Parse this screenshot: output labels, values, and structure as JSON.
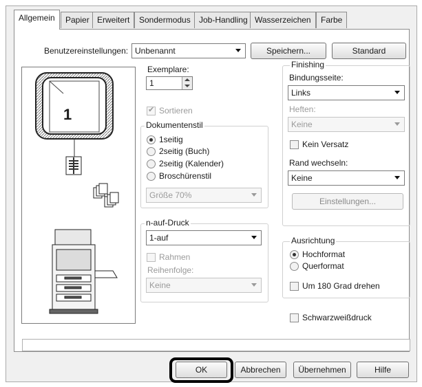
{
  "tabs": [
    {
      "label": "Allgemein"
    },
    {
      "label": "Papier"
    },
    {
      "label": "Erweitert"
    },
    {
      "label": "Sondermodus"
    },
    {
      "label": "Job-Handling"
    },
    {
      "label": "Wasserzeichen"
    },
    {
      "label": "Farbe"
    }
  ],
  "user_settings": {
    "label": "Benutzereinstellungen:",
    "value": "Unbenannt",
    "save_button": "Speichern...",
    "default_button": "Standard"
  },
  "preview": {
    "page_number": "1"
  },
  "copies": {
    "label": "Exemplare:",
    "value": "1",
    "collate_label": "Sortieren",
    "collate_checked": true,
    "collate_enabled": false
  },
  "document_style": {
    "title": "Dokumentenstil",
    "options": [
      "1seitig",
      "2seitig (Buch)",
      "2seitig (Kalender)",
      "Broschürenstil"
    ],
    "selected": "1seitig",
    "size_value": "Größe 70%"
  },
  "n_up": {
    "title": "n-auf-Druck",
    "value": "1-auf",
    "border_label": "Rahmen",
    "order_label": "Reihenfolge:",
    "order_value": "Keine"
  },
  "finishing": {
    "title": "Finishing",
    "binding_label": "Bindungsseite:",
    "binding_value": "Links",
    "staple_label": "Heften:",
    "staple_value": "Keine",
    "no_offset_label": "Kein Versatz",
    "margin_shift_label": "Rand wechseln:",
    "margin_shift_value": "Keine",
    "settings_button": "Einstellungen..."
  },
  "orientation": {
    "title": "Ausrichtung",
    "options": [
      "Hochformat",
      "Querformat"
    ],
    "selected": "Hochformat",
    "rotate_label": "Um 180 Grad drehen"
  },
  "bw_print_label": "Schwarzweißdruck",
  "footer": {
    "ok": "OK",
    "cancel": "Abbrechen",
    "apply": "Übernehmen",
    "help": "Hilfe"
  },
  "colors": {
    "ok_highlight": "#000000"
  }
}
